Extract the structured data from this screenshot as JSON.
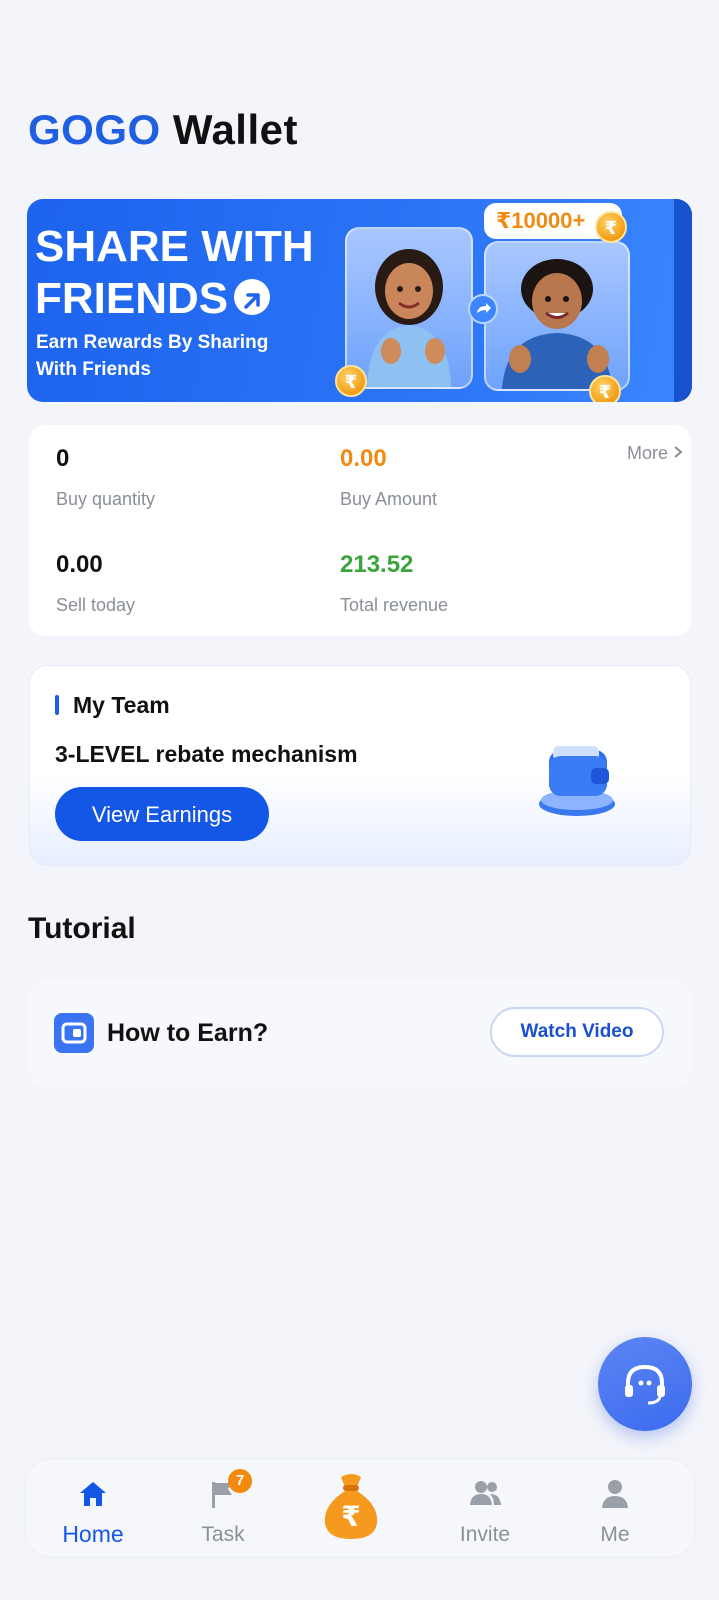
{
  "header": {
    "brand": "GOGO",
    "title_rest": "Wallet"
  },
  "banner": {
    "headline_line1": "SHARE WITH",
    "headline_line2": "FRIENDS",
    "subtitle_line1": "Earn Rewards By Sharing",
    "subtitle_line2": "With Friends",
    "reward_badge": "₹10000+"
  },
  "stats": {
    "more_label": "More",
    "buy_quantity": {
      "value": "0",
      "label": "Buy quantity"
    },
    "buy_amount": {
      "value": "0.00",
      "label": "Buy Amount"
    },
    "sell_today": {
      "value": "0.00",
      "label": "Sell today"
    },
    "total_revenue": {
      "value": "213.52",
      "label": "Total revenue"
    },
    "colors": {
      "buy_amount": "#f08a12",
      "total_revenue": "#3aa53a"
    }
  },
  "team": {
    "title": "My Team",
    "description": "3-LEVEL rebate mechanism",
    "button_label": "View Earnings"
  },
  "tutorial": {
    "title": "Tutorial",
    "item_label": "How to Earn?",
    "button_label": "Watch Video"
  },
  "nav": {
    "items": [
      {
        "label": "Home",
        "icon": "home-icon",
        "active": true
      },
      {
        "label": "Task",
        "icon": "flag-icon",
        "badge": "7"
      },
      {
        "label": "",
        "icon": "money-bag-icon"
      },
      {
        "label": "Invite",
        "icon": "users-icon"
      },
      {
        "label": "Me",
        "icon": "person-icon"
      }
    ]
  },
  "accent_color": "#1f5fe0"
}
